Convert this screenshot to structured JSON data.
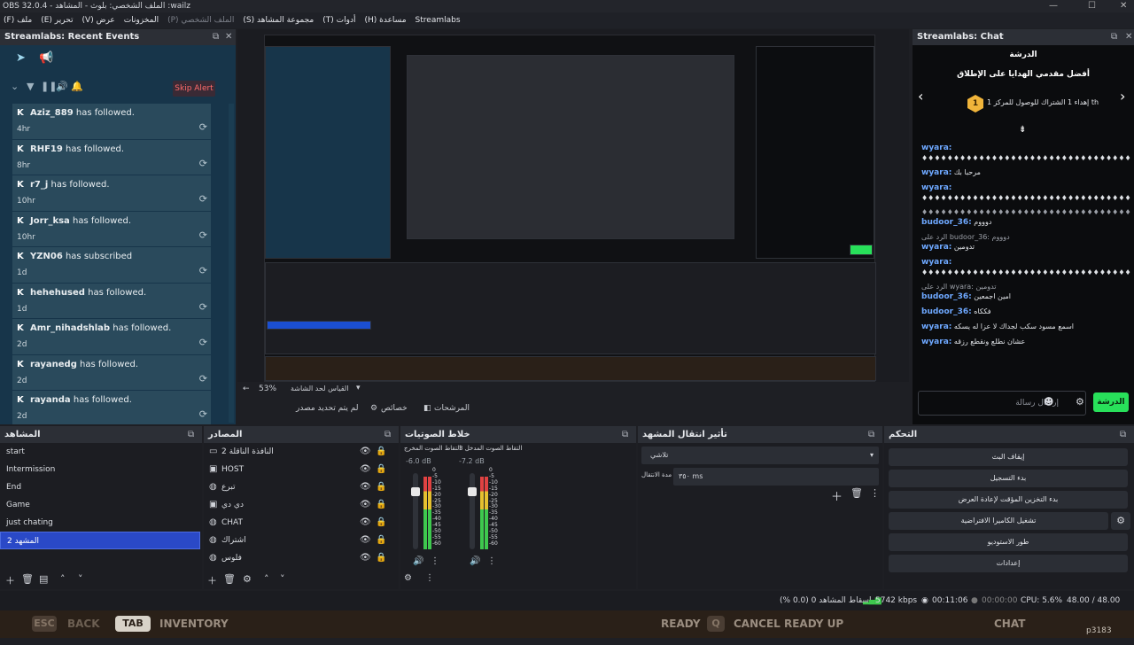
{
  "window": {
    "title": "OBS 32.0.4 - الملف الشخصي: بلوث - المشاهد :wailz"
  },
  "menu": [
    {
      "label": "(F) ملف",
      "dim": false
    },
    {
      "label": "(E) تحرير",
      "dim": false
    },
    {
      "label": "(V) عرض",
      "dim": false
    },
    {
      "label": "المخزونات",
      "dim": false
    },
    {
      "label": "(P) الملف الشخصي",
      "dim": true
    },
    {
      "label": "(S) مجموعة المشاهد",
      "dim": false
    },
    {
      "label": "(T) أدوات",
      "dim": false
    },
    {
      "label": "(H) مساعدة",
      "dim": false
    },
    {
      "label": "Streamlabs",
      "dim": false
    }
  ],
  "events_panel": {
    "title": "Streamlabs: Recent Events",
    "skip_alert": "Skip Alert",
    "items": [
      {
        "name": "Aziz_889",
        "action": " has followed.",
        "time": "4hr"
      },
      {
        "name": "RHF19",
        "action": " has followed.",
        "time": "8hr"
      },
      {
        "name": "r7_j",
        "action": " has followed.",
        "time": "10hr"
      },
      {
        "name": "Jorr_ksa",
        "action": " has followed.",
        "time": "10hr"
      },
      {
        "name": "YZN06",
        "action": " has subscribed",
        "time": "1d"
      },
      {
        "name": "hehehused",
        "action": " has followed.",
        "time": "1d"
      },
      {
        "name": "Amr_nihadshlab",
        "action": " has followed.",
        "time": "2d"
      },
      {
        "name": "rayanedg",
        "action": " has followed.",
        "time": "2d"
      },
      {
        "name": "rayanda",
        "action": " has followed.",
        "time": "2d"
      }
    ]
  },
  "preview": {
    "zoom": "53%",
    "fit_label": "القياس لحد الشاشة",
    "no_source": "لم يتم تحديد مصدر",
    "properties": "خصائص",
    "filters": "المرشحات"
  },
  "chat_panel": {
    "title": "Streamlabs: Chat",
    "banner_title": "الدرشة",
    "banner_sub": "أفضل مقدمي الهدايا على الإطلاق",
    "banner_gift": "إهداء 1 الشتراك للوصول للمركز 1 th",
    "messages": [
      {
        "user": "wyara:",
        "text": "♦♦♦♦♦♦♦♦♦♦♦♦♦♦♦♦♦♦♦♦♦♦♦♦♦♦♦♦♦♦♦♦♦♦♦♦♦♦♦♦♦♦♦♦♦♦♦♦♦♦♦♦♦♦♦♦♦♦♦♦♦♦♦♦",
        "color": "#6ea8ff",
        "reply": ""
      },
      {
        "user": "wyara:",
        "text": "مرحبا بك",
        "color": "#6ea8ff",
        "reply": ""
      },
      {
        "user": "wyara:",
        "text": "♦♦♦♦♦♦♦♦♦♦♦♦♦♦♦♦♦♦♦♦♦♦♦♦♦♦♦♦♦♦♦♦♦♦♦♦♦♦",
        "color": "#6ea8ff",
        "reply": ""
      },
      {
        "user": "budoor_36:",
        "text": "دوووم",
        "color": "#6ea8ff",
        "reply": "♦♦♦♦♦♦♦♦♦♦♦♦♦♦♦♦♦♦♦♦♦♦♦♦♦♦♦♦♦♦♦♦♦♦♦♦"
      },
      {
        "user": "wyara:",
        "text": "تدومين",
        "color": "#6ea8ff",
        "reply": "الرد على budoor_36: دوووم"
      },
      {
        "user": "wyara:",
        "text": "♦♦♦♦♦♦♦♦♦♦♦♦♦♦♦♦♦♦♦♦♦♦♦♦♦♦♦♦♦♦♦♦♦♦♦♦♦♦♦♦♦♦♦♦♦♦♦♦♦♦♦♦♦♦♦♦♦♦♦♦♦♦♦♦♦♦♦♦♦♦♦♦♦♦♦♦♦♦",
        "color": "#6ea8ff",
        "reply": ""
      },
      {
        "user": "budoor_36:",
        "text": "امين اجمعين",
        "color": "#6ea8ff",
        "reply": "الرد على wyara: تدومين"
      },
      {
        "user": "budoor_36:",
        "text": "فككاه",
        "color": "#6ea8ff",
        "reply": ""
      },
      {
        "user": "wyara:",
        "text": "اسمع مسود سكب لجداك لا عزا له يسكه",
        "color": "#6ea8ff",
        "reply": ""
      },
      {
        "user": "wyara:",
        "text": "عشان نطلع ونقطع رزقه",
        "color": "#6ea8ff",
        "reply": ""
      }
    ],
    "input_placeholder": "إرسال رسالة",
    "send": "الدرشة"
  },
  "scenes": {
    "title": "المشاهد",
    "items": [
      "start",
      "Intermission",
      "End",
      "Game",
      "just chating",
      "المشهد 2"
    ],
    "selected": 5
  },
  "sources": {
    "title": "المصادر",
    "items": [
      "النافذة الناقلة 2",
      "HOST",
      "تبرع",
      "دي دي",
      "CHAT",
      "اشتراك",
      "فلوس"
    ]
  },
  "mixer": {
    "title": "خلاط الصوتيات",
    "ch1_name": "التقاط الصوت المخرج",
    "ch1_db": "-6.0 dB",
    "ch2_name": "التقاط الصوت المدخل 3",
    "ch2_db": "-7.2 dB",
    "scale": [
      "0",
      "-5",
      "-10",
      "-15",
      "-20",
      "-25",
      "-30",
      "-35",
      "-40",
      "-45",
      "-50",
      "-55",
      "-60"
    ]
  },
  "transitions": {
    "title": "تأثير انتقال المشهد",
    "type": "تلاشي",
    "duration_label": "مدة الانتقال",
    "duration": "٣٥٠ ms"
  },
  "controls": {
    "title": "التحكم",
    "buttons": [
      "إيقاف البث",
      "بدء التسجيل",
      "بدء التخزين المؤقت لإعادة العرض",
      "تشغيل الكاميرا الافتراضية",
      "طور الاستوديو",
      "إعدادات"
    ]
  },
  "status": {
    "dropped": "إسقاط المشاهد 0 (0.0 %)",
    "bitrate": "5742 kbps",
    "stream_time": "00:11:06",
    "rec_time": "00:00:00",
    "cpu": "CPU: 5.6%",
    "fps": "48.00 / 48.00 FPS"
  },
  "footer": {
    "esc": "ESC",
    "back": "BACK",
    "tab": "TAB",
    "inventory": "INVENTORY",
    "ready": "READY",
    "q": "Q",
    "cancel": "CANCEL READY UP",
    "chat": "CHAT",
    "id": "p3183"
  }
}
